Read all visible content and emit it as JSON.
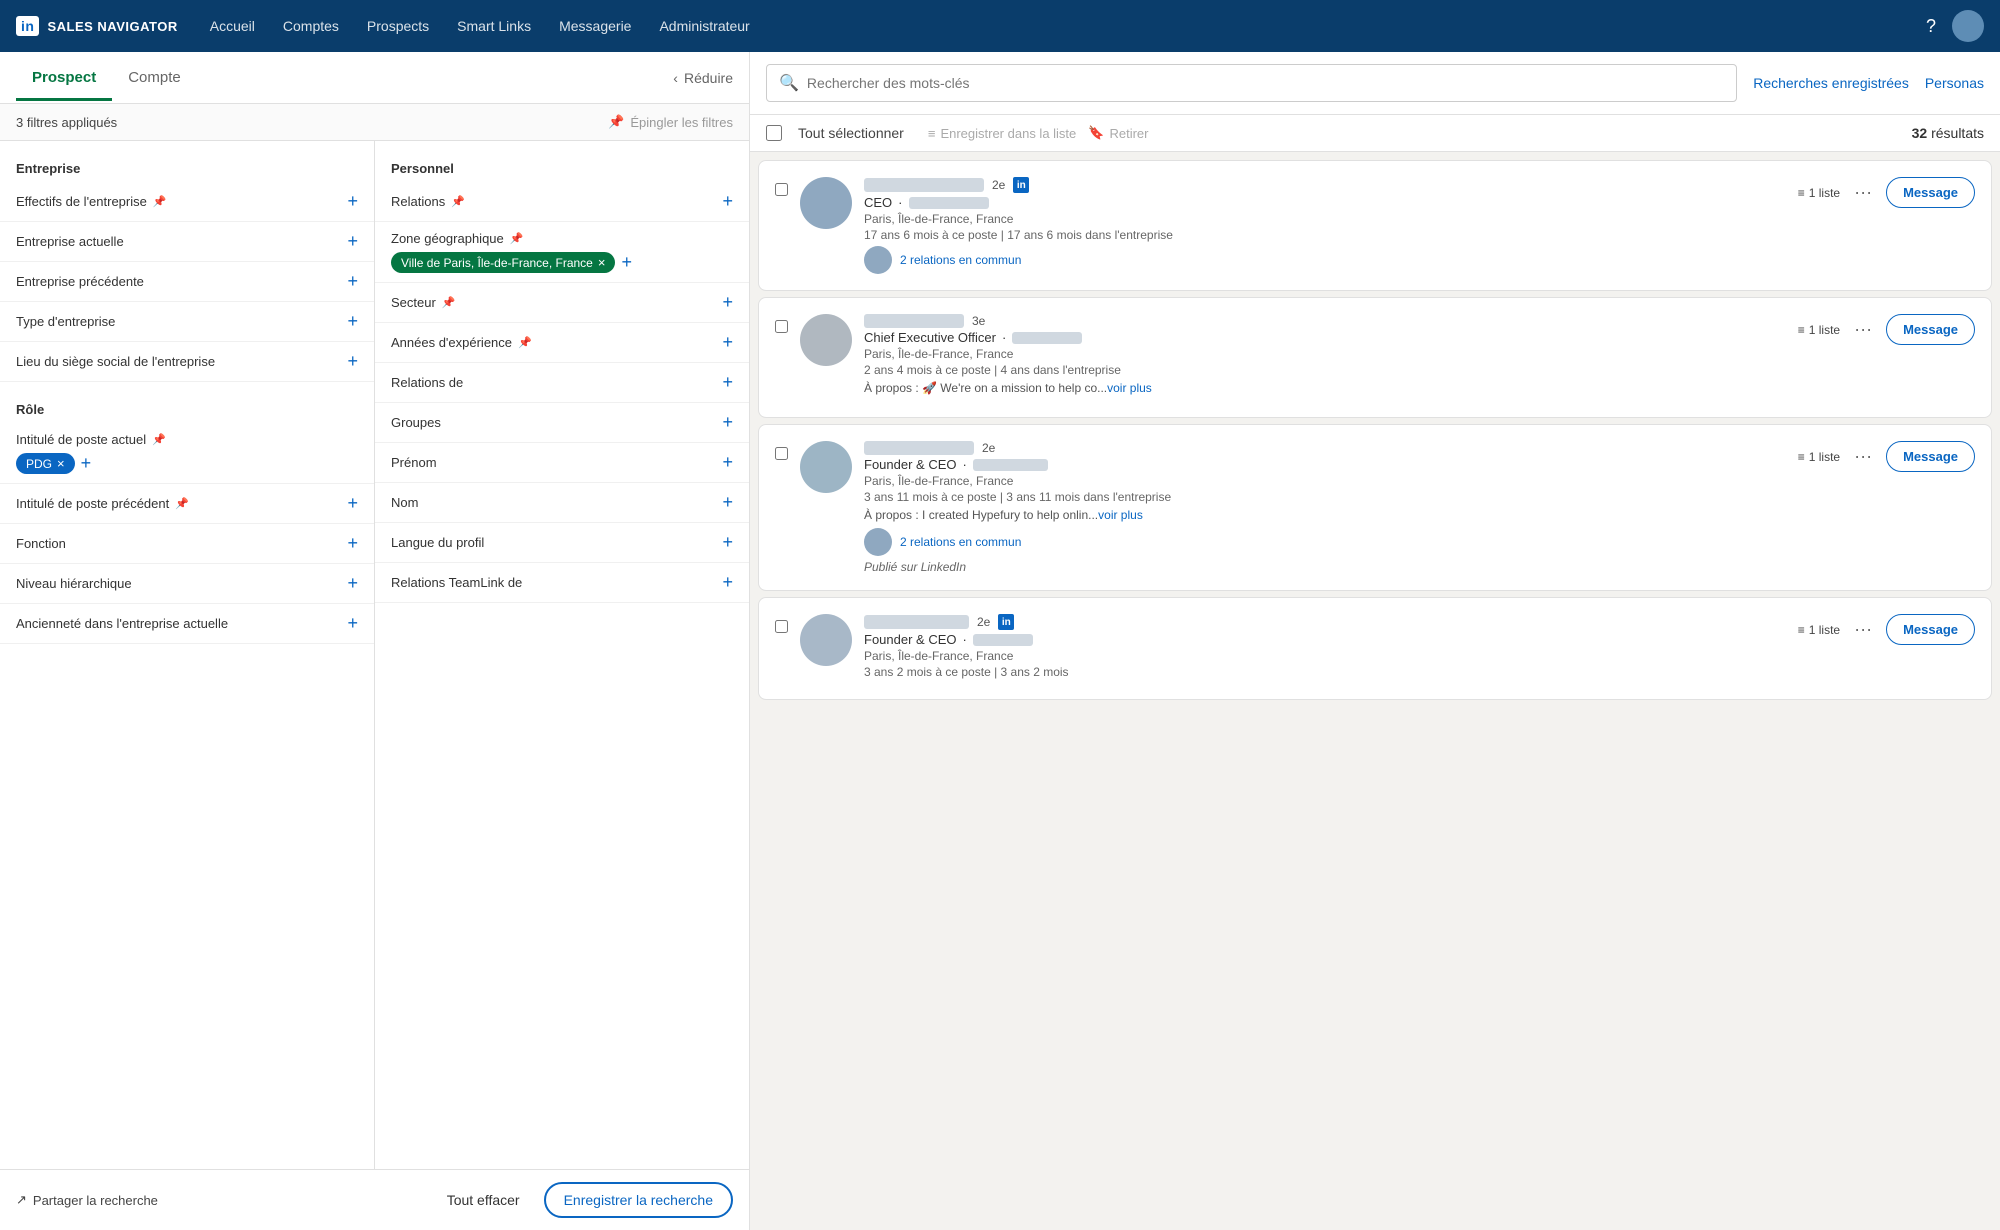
{
  "nav": {
    "logo": "in",
    "title": "SALES NAVIGATOR",
    "links": [
      "Accueil",
      "Comptes",
      "Prospects",
      "Smart Links",
      "Messagerie",
      "Administrateur"
    ]
  },
  "tabs": {
    "prospect_label": "Prospect",
    "compte_label": "Compte",
    "reduce_label": "Réduire"
  },
  "filters": {
    "applied_label": "3 filtres appliqués",
    "pin_label": "Épingler les filtres",
    "entreprise_title": "Entreprise",
    "personnel_title": "Personnel",
    "entreprise_items": [
      "Effectifs de l'entreprise",
      "Entreprise actuelle",
      "Entreprise précédente",
      "Type d'entreprise",
      "Lieu du siège social de l'entreprise"
    ],
    "role_title": "Rôle",
    "role_items": [
      {
        "label": "Intitulé de poste actuel",
        "has_tag": true,
        "tag": "PDG"
      },
      {
        "label": "Intitulé de poste précédent"
      },
      {
        "label": "Fonction"
      },
      {
        "label": "Niveau hiérarchique"
      },
      {
        "label": "Ancienneté dans l'entreprise actuelle"
      }
    ],
    "personnel_items": [
      {
        "label": "Relations",
        "has_tag": false
      },
      {
        "label": "Zone géographique",
        "has_tag": true,
        "tag": "Ville de Paris, Île-de-France, France"
      },
      {
        "label": "Secteur"
      },
      {
        "label": "Années d'expérience"
      },
      {
        "label": "Relations de"
      },
      {
        "label": "Groupes"
      },
      {
        "label": "Prénom"
      },
      {
        "label": "Nom"
      },
      {
        "label": "Langue du profil"
      },
      {
        "label": "Relations TeamLink de"
      }
    ],
    "share_label": "Partager la recherche",
    "clear_label": "Tout effacer",
    "save_label": "Enregistrer la recherche"
  },
  "search": {
    "placeholder": "Rechercher des mots-clés",
    "saved_label": "Recherches enregistrées",
    "personas_label": "Personas"
  },
  "results": {
    "select_all_label": "Tout sélectionner",
    "save_list_label": "Enregistrer dans la liste",
    "retire_label": "Retirer",
    "count": "32",
    "count_label": "résultats"
  },
  "profiles": [
    {
      "degree": "2e",
      "has_li": true,
      "name_width": 120,
      "title": "CEO",
      "company_width": 80,
      "location": "Paris, Île-de-France, France",
      "tenure": "17 ans 6 mois à ce poste | 17 ans 6 mois dans l'entreprise",
      "has_relations": true,
      "relations_count": "2 relations en commun",
      "liste_label": "1 liste",
      "message_label": "Message"
    },
    {
      "degree": "3e",
      "has_li": false,
      "name_width": 100,
      "title": "Chief Executive Officer",
      "company_width": 70,
      "location": "Paris, Île-de-France, France",
      "tenure": "2 ans 4 mois à ce poste | 4 ans dans l'entreprise",
      "has_about": true,
      "about": "À propos : 🚀 We're on a mission to help co...",
      "voir_plus": "voir plus",
      "has_relations": false,
      "liste_label": "1 liste",
      "message_label": "Message"
    },
    {
      "degree": "2e",
      "has_li": false,
      "name_width": 110,
      "title": "Founder & CEO",
      "company_width": 75,
      "location": "Paris, Île-de-France, France",
      "tenure": "3 ans 11 mois à ce poste | 3 ans 11 mois dans l'entreprise",
      "has_about": true,
      "about": "À propos : I created Hypefury to help onlin...",
      "voir_plus": "voir plus",
      "has_relations": true,
      "relations_count": "2 relations en commun",
      "published": "Publié sur LinkedIn",
      "liste_label": "1 liste",
      "message_label": "Message"
    },
    {
      "degree": "2e",
      "has_li": true,
      "name_width": 105,
      "title": "Founder & CEO",
      "company_width": 60,
      "location": "Paris, Île-de-France, France",
      "tenure": "3 ans 2 mois à ce poste | 3 ans 2 mois",
      "has_relations": false,
      "liste_label": "1 liste",
      "message_label": "Message"
    }
  ]
}
